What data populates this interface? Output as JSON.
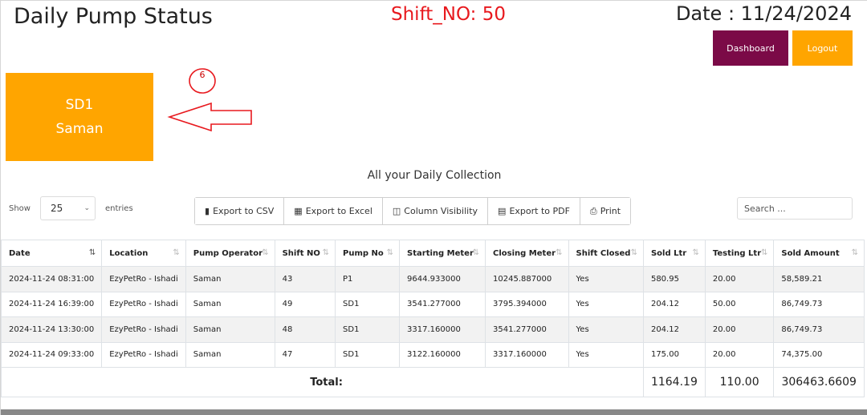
{
  "header": {
    "title": "Daily Pump Status",
    "shift_no": "Shift_NO: 50",
    "date": "Date : 11/24/2024",
    "dashboard_label": "Dashboard",
    "logout_label": "Logout"
  },
  "pump_card": {
    "pump": "SD1",
    "operator": "Saman"
  },
  "annotation": {
    "badge": "6",
    "color": "#e8191e"
  },
  "table_caption": "All your Daily Collection",
  "controls": {
    "show_label": "Show",
    "entries_value": "25",
    "entries_label": "entries",
    "export_buttons": [
      {
        "label": "Export to CSV",
        "icon": "file-icon"
      },
      {
        "label": "Export to Excel",
        "icon": "excel-icon"
      },
      {
        "label": "Column Visibility",
        "icon": "columns-icon"
      },
      {
        "label": "Export to PDF",
        "icon": "pdf-icon"
      },
      {
        "label": "Print",
        "icon": "print-icon"
      }
    ],
    "search_placeholder": "Search ..."
  },
  "table": {
    "columns": [
      "Date",
      "Location",
      "Pump Operator",
      "Shift NO",
      "Pump No",
      "Starting Meter",
      "Closing Meter",
      "Shift Closed",
      "Sold Ltr",
      "Testing Ltr",
      "Sold Amount"
    ],
    "rows": [
      [
        "2024-11-24 08:31:00",
        "EzyPetRo - Ishadi",
        "Saman",
        "43",
        "P1",
        "9644.933000",
        "10245.887000",
        "Yes",
        "580.95",
        "20.00",
        "58,589.21"
      ],
      [
        "2024-11-24 16:39:00",
        "EzyPetRo - Ishadi",
        "Saman",
        "49",
        "SD1",
        "3541.277000",
        "3795.394000",
        "Yes",
        "204.12",
        "50.00",
        "86,749.73"
      ],
      [
        "2024-11-24 13:30:00",
        "EzyPetRo - Ishadi",
        "Saman",
        "48",
        "SD1",
        "3317.160000",
        "3541.277000",
        "Yes",
        "204.12",
        "20.00",
        "86,749.73"
      ],
      [
        "2024-11-24 09:33:00",
        "EzyPetRo - Ishadi",
        "Saman",
        "47",
        "SD1",
        "3122.160000",
        "3317.160000",
        "Yes",
        "175.00",
        "20.00",
        "74,375.00"
      ]
    ],
    "footer": {
      "label": "Total:",
      "sold_ltr": "1164.19",
      "testing_ltr": "110.00",
      "sold_amount": "306463.6609"
    }
  },
  "colors": {
    "dashboard": "#7b0a47",
    "logout": "#ffa500",
    "pump_card": "#ffa500",
    "shift_no": "#e8191e"
  }
}
